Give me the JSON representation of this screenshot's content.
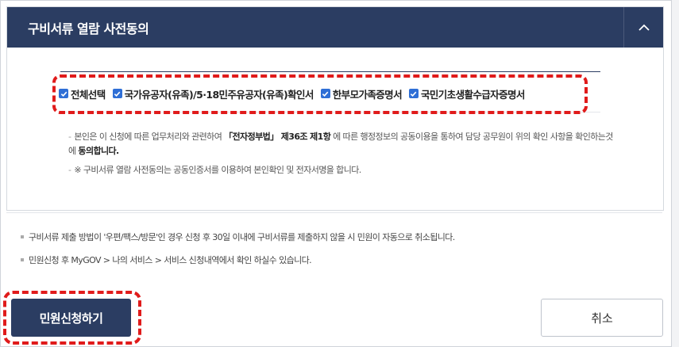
{
  "section": {
    "title": "구비서류 열람 사전동의",
    "collapse_icon": "chevron-up-icon"
  },
  "checkboxes": [
    {
      "label": "전체선택",
      "checked": true
    },
    {
      "label": "국가유공자(유족)/5·18민주유공자(유족)확인서",
      "checked": true
    },
    {
      "label": "한부모가족증명서",
      "checked": true
    },
    {
      "label": "국민기초생활수급자증명서",
      "checked": true
    }
  ],
  "notice": {
    "line1_a": "본인은 이 신청에 따른 업무처리와 관련하여 ",
    "line1_b": "「전자정부법」 제36조 제1항",
    "line1_c": " 에 따른 행정정보의 공동이용을 통하여 담당 공무원이 위의 확인 사항을 확인하는것에 ",
    "line1_d": "동의합니다.",
    "line2": "※ 구비서류 열람 사전동의는 공동인증서를 이용하여 본인확인 및 전자서명을 합니다."
  },
  "info": {
    "line1": "구비서류 제출 방법이 '우편/팩스/방문'인 경우 신청 후 30일 이내에 구비서류를 제출하지 않을 시 민원이 자동으로 취소됩니다.",
    "line2": "민원신청 후 MyGOV > 나의 서비스 > 서비스 신청내역에서 확인 하실수 있습니다."
  },
  "buttons": {
    "apply": "민원신청하기",
    "cancel": "취소"
  },
  "colors": {
    "header_bg": "#2b3d62",
    "checkbox": "#2f6fd6",
    "highlight": "#e01b1b"
  }
}
